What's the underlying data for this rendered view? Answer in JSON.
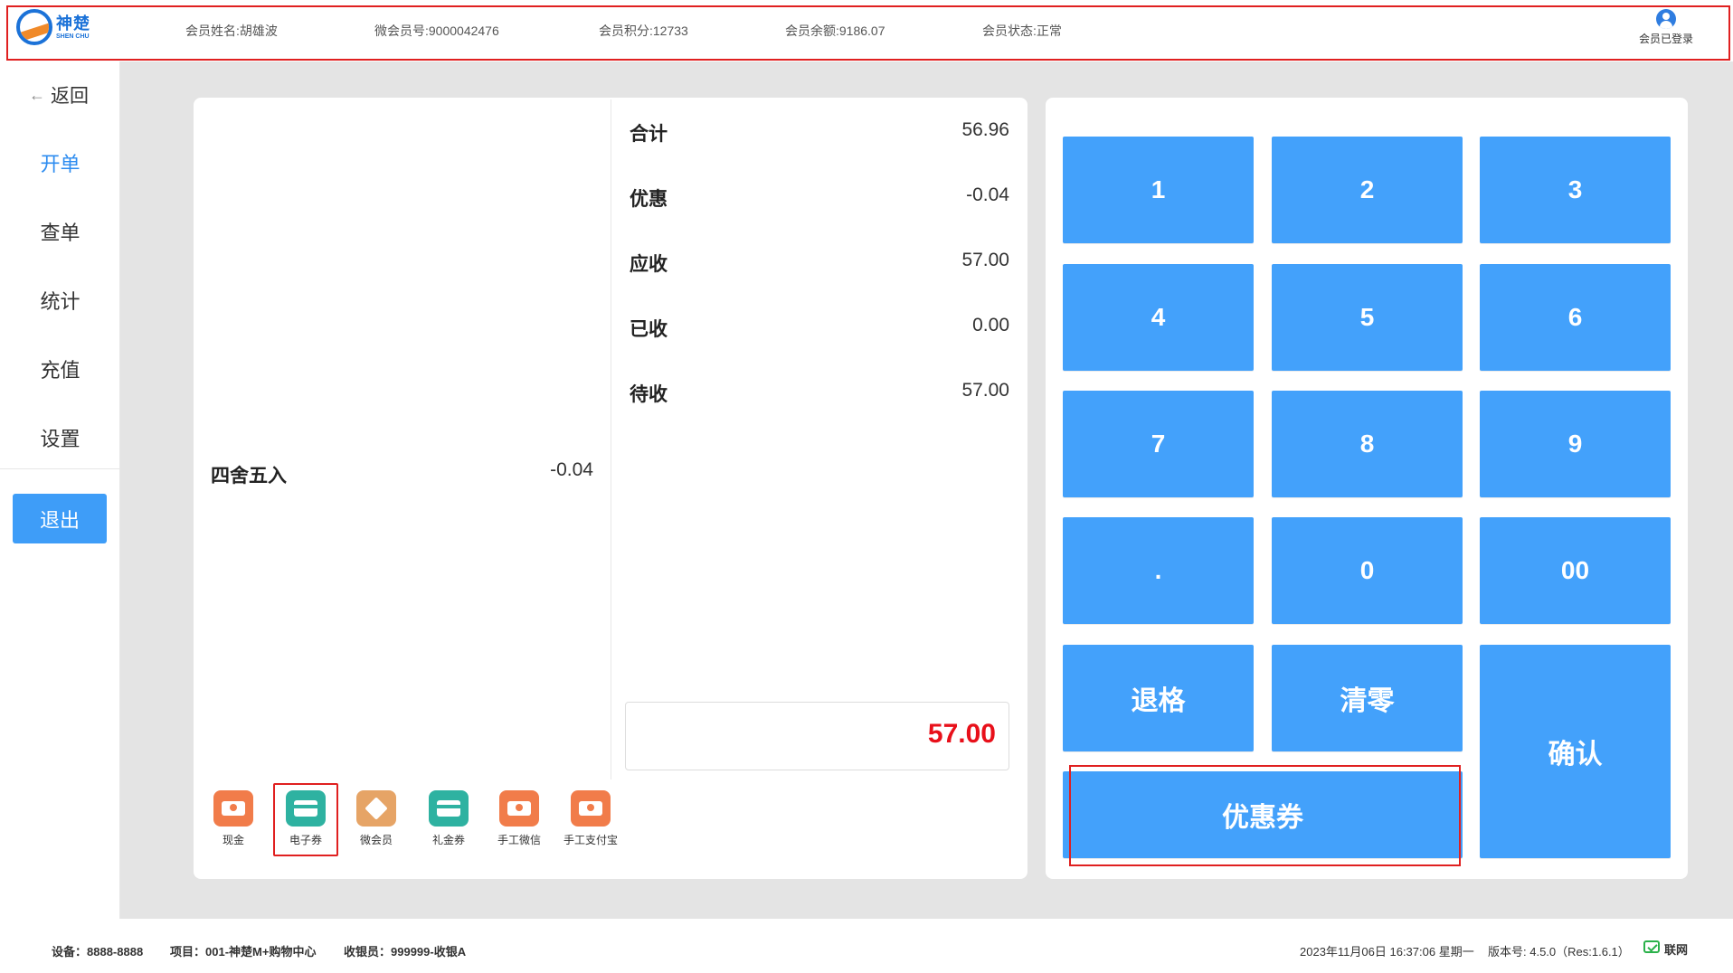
{
  "header": {
    "logo_cn": "神楚",
    "logo_en": "SHEN CHU",
    "member_name": "会员姓名:胡雄波",
    "member_no": "微会员号:9000042476",
    "member_points": "会员积分:12733",
    "member_balance": "会员余额:9186.07",
    "member_status": "会员状态:正常",
    "login_status": "会员已登录"
  },
  "sidebar": {
    "back": "返回",
    "items": [
      {
        "label": "开单",
        "active": true
      },
      {
        "label": "查单"
      },
      {
        "label": "统计"
      },
      {
        "label": "充值"
      },
      {
        "label": "设置"
      }
    ],
    "logout": "退出"
  },
  "order": {
    "rounding_label": "四舍五入",
    "rounding_value": "-0.04"
  },
  "summary": {
    "total_label": "合计",
    "total_value": "56.96",
    "discount_label": "优惠",
    "discount_value": "-0.04",
    "receivable_label": "应收",
    "receivable_value": "57.00",
    "received_label": "已收",
    "received_value": "0.00",
    "pending_label": "待收",
    "pending_value": "57.00",
    "amount_input": "57.00"
  },
  "pay_methods": [
    "现金",
    "电子券",
    "微会员",
    "礼金券",
    "手工微信",
    "手工支付宝"
  ],
  "keypad": {
    "k1": "1",
    "k2": "2",
    "k3": "3",
    "k4": "4",
    "k5": "5",
    "k6": "6",
    "k7": "7",
    "k8": "8",
    "k9": "9",
    "kdot": ".",
    "k0": "0",
    "k00": "00",
    "backspace": "退格",
    "clear": "清零",
    "confirm": "确认",
    "coupon": "优惠券"
  },
  "footer": {
    "device": "设备：8888-8888",
    "project": "项目：001-神楚M+购物中心",
    "cashier": "收银员：999999-收银A",
    "datetime": "2023年11月06日 16:37:06 星期一",
    "version": "版本号: 4.5.0（Res:1.6.1）",
    "network": "联网"
  },
  "colors": {
    "accent": "#2d8cf0",
    "key_blue": "#43a1fb",
    "highlight_red": "#e02020",
    "amount_red": "#e8101a"
  }
}
